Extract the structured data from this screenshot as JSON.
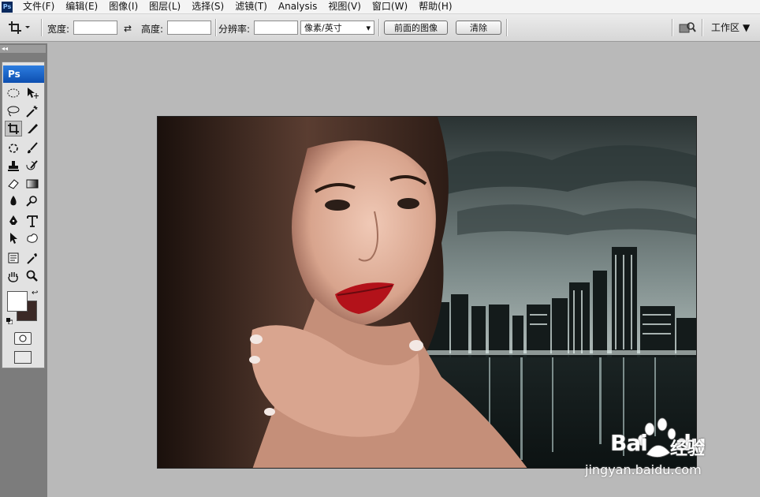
{
  "app": {
    "logo_text": "Ps"
  },
  "menu": [
    "文件(F)",
    "编辑(E)",
    "图像(I)",
    "图层(L)",
    "选择(S)",
    "滤镜(T)",
    "Analysis",
    "视图(V)",
    "窗口(W)",
    "帮助(H)"
  ],
  "options": {
    "width_label": "宽度:",
    "height_label": "高度:",
    "resolution_label": "分辨率:",
    "width_value": "",
    "height_value": "",
    "resolution_value": "",
    "unit_selected": "像素/英寸",
    "front_image_button": "前面的图像",
    "clear_button": "清除",
    "workspace_label": "工作区"
  },
  "toolbox": {
    "title": "Ps",
    "collapse": "◂◂"
  },
  "colors": {
    "foreground": "#ffffff",
    "background": "#3b2926",
    "accent": "#1e64c8"
  },
  "watermark": {
    "brand": "Bai",
    "brand2": "du",
    "cn": "经验",
    "url": "jingyan.baidu.com"
  }
}
